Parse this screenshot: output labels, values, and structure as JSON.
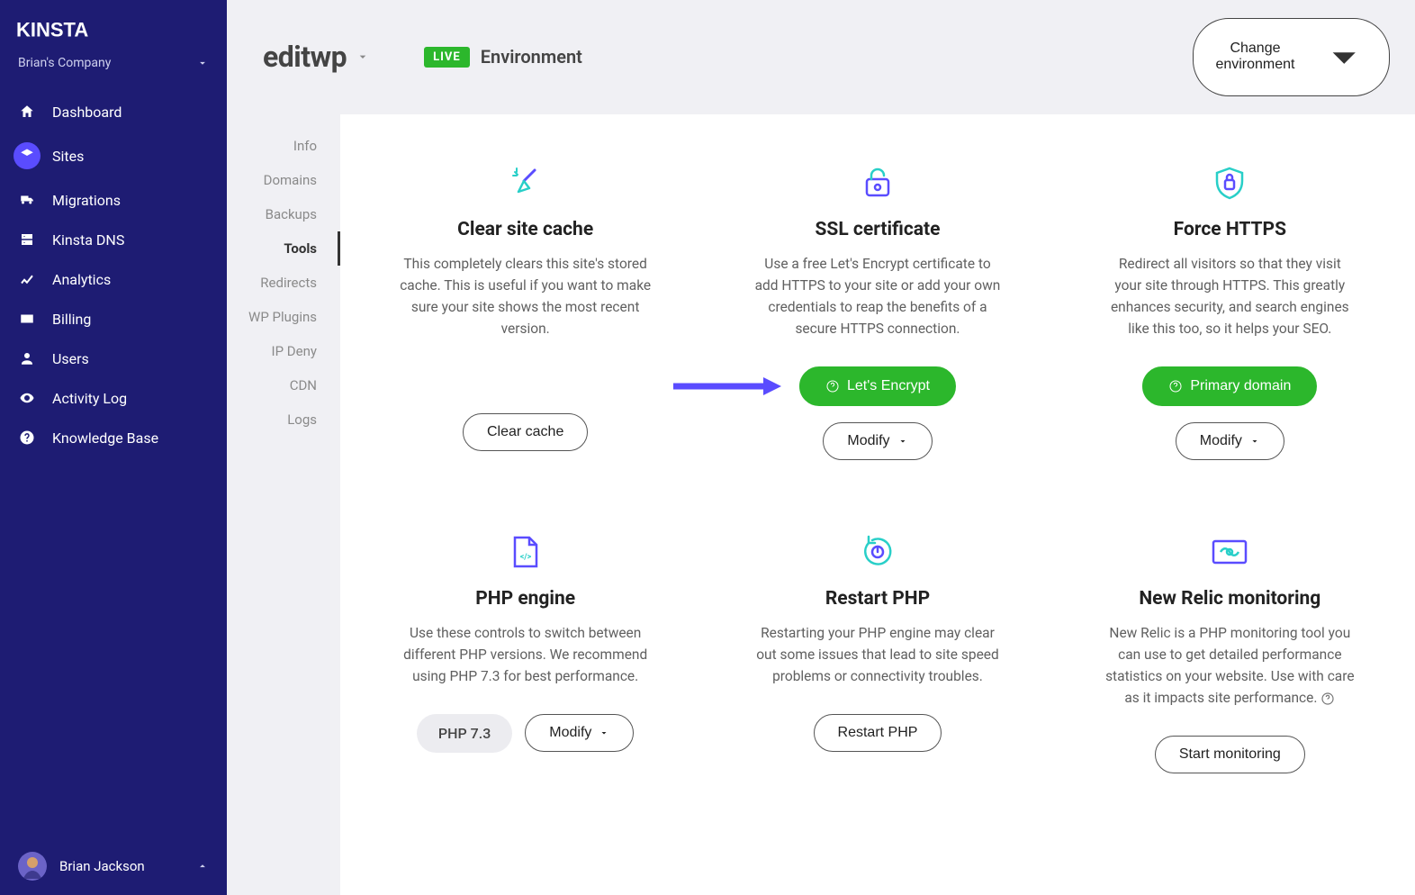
{
  "sidebar": {
    "company": "Brian's Company",
    "items": [
      {
        "label": "Dashboard"
      },
      {
        "label": "Sites"
      },
      {
        "label": "Migrations"
      },
      {
        "label": "Kinsta DNS"
      },
      {
        "label": "Analytics"
      },
      {
        "label": "Billing"
      },
      {
        "label": "Users"
      },
      {
        "label": "Activity Log"
      },
      {
        "label": "Knowledge Base"
      }
    ],
    "user": "Brian Jackson"
  },
  "header": {
    "site_title": "editwp",
    "env_badge": "LIVE",
    "env_label": "Environment",
    "change_button": "Change environment"
  },
  "subnav": {
    "items": [
      {
        "label": "Info"
      },
      {
        "label": "Domains"
      },
      {
        "label": "Backups"
      },
      {
        "label": "Tools"
      },
      {
        "label": "Redirects"
      },
      {
        "label": "WP Plugins"
      },
      {
        "label": "IP Deny"
      },
      {
        "label": "CDN"
      },
      {
        "label": "Logs"
      }
    ]
  },
  "cards": {
    "clear_cache": {
      "title": "Clear site cache",
      "desc": "This completely clears this site's stored cache. This is useful if you want to make sure your site shows the most recent version.",
      "action": "Clear cache"
    },
    "ssl": {
      "title": "SSL certificate",
      "desc": "Use a free Let's Encrypt certificate to add HTTPS to your site or add your own credentials to reap the benefits of a secure HTTPS connection.",
      "primary": "Let's Encrypt",
      "secondary": "Modify"
    },
    "force_https": {
      "title": "Force HTTPS",
      "desc": "Redirect all visitors so that they visit your site through HTTPS. This greatly enhances security, and search engines like this too, so it helps your SEO.",
      "primary": "Primary domain",
      "secondary": "Modify"
    },
    "php_engine": {
      "title": "PHP engine",
      "desc": "Use these controls to switch between different PHP versions. We recommend using PHP 7.3 for best performance.",
      "version": "PHP 7.3",
      "secondary": "Modify"
    },
    "restart_php": {
      "title": "Restart PHP",
      "desc": "Restarting your PHP engine may clear out some issues that lead to site speed problems or connectivity troubles.",
      "action": "Restart PHP"
    },
    "new_relic": {
      "title": "New Relic monitoring",
      "desc": "New Relic is a PHP monitoring tool you can use to get detailed performance statistics on your website. Use with care as it impacts site performance.",
      "action": "Start monitoring"
    }
  }
}
